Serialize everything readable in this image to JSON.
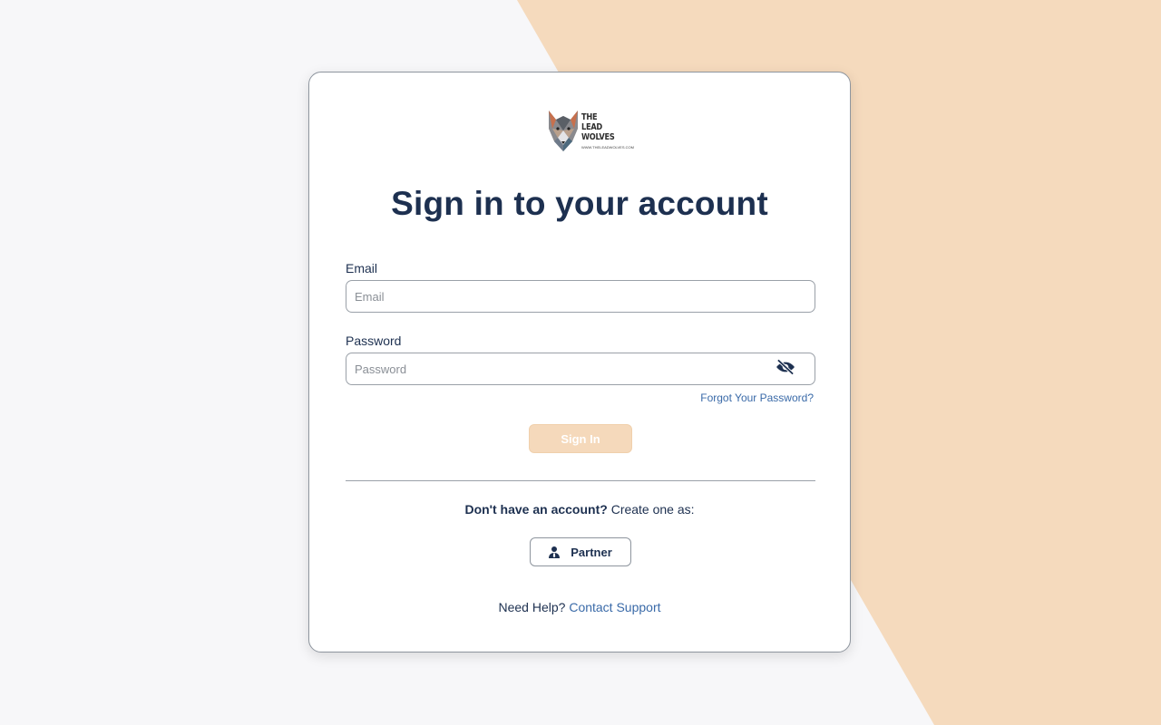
{
  "colors": {
    "background": "#f7f7f9",
    "accent_shape": "#f5dabd",
    "primary_text": "#1d3050",
    "link": "#3a6aa8",
    "button_disabled": "#f5d9bb"
  },
  "logo": {
    "line1": "THE",
    "line2": "LEAD",
    "line3": "WOLVES",
    "url": "WWW.THELEADWOLVES.COM",
    "icon": "wolf-icon"
  },
  "title": "Sign in to your account",
  "form": {
    "email_label": "Email",
    "email_value": "",
    "email_placeholder": "Email",
    "password_label": "Password",
    "password_value": "",
    "password_placeholder": "Password",
    "password_toggle_icon": "eye-slash-icon",
    "forgot_link": "Forgot Your Password?",
    "submit_label": "Sign In"
  },
  "signup": {
    "prompt_bold": "Don't have an account?",
    "prompt_rest": " Create one as:",
    "partner_label": "Partner",
    "partner_icon": "user-tie-icon"
  },
  "help": {
    "text": "Need Help? ",
    "link": "Contact Support"
  }
}
